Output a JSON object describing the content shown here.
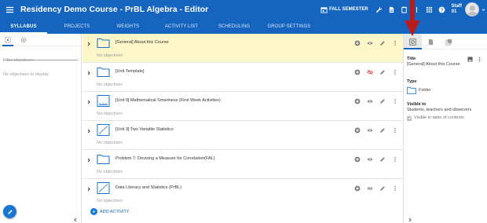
{
  "app": {
    "title": "Residency Demo Course - PrBL Algebra - Editor",
    "semester": "FALL SEMESTER",
    "user_line1": "Staff",
    "user_line2": "01"
  },
  "nav": {
    "tabs": [
      {
        "label": "SYLLABUS",
        "active": true
      },
      {
        "label": "PROJECTS",
        "active": false
      },
      {
        "label": "WEIGHTS",
        "active": false
      },
      {
        "label": "ACTIVITY LIST",
        "active": false
      },
      {
        "label": "SCHEDULING",
        "active": false
      },
      {
        "label": "GROUP SETTINGS",
        "active": false
      }
    ]
  },
  "left": {
    "filter_placeholder": "Filter objectives",
    "empty_text": "No objectives to display"
  },
  "activities": [
    {
      "title": "[General] About this Course",
      "subtitle": "No objectives",
      "icon": "folder-icon",
      "selected": true,
      "hidden": false
    },
    {
      "title": "[Unit Template]",
      "subtitle": "No objectives",
      "icon": "folder-icon",
      "selected": false,
      "hidden": true
    },
    {
      "title": "[Unit 0] Mathematical Smartness (First Week Activities)",
      "subtitle": "No objectives",
      "icon": "chart-icon",
      "selected": false,
      "hidden": false
    },
    {
      "title": "[Unit 3] Two Variable Statistics",
      "subtitle": "No objectives",
      "icon": "line-chart-icon",
      "selected": false,
      "hidden": false
    },
    {
      "title": "Problem 7: Devising a Measure for Correlation(FAL)",
      "subtitle": "No objectives",
      "icon": "folder-icon",
      "selected": false,
      "hidden": false
    },
    {
      "title": "Data Literacy and Statistics (PrBL)",
      "subtitle": "No objectives",
      "icon": "line-chart-icon",
      "selected": false,
      "hidden": false
    }
  ],
  "add_activity_label": "ADD ACTIVITY",
  "properties": {
    "title_label": "Title",
    "title_value": "[General] About this Course",
    "type_label": "Type",
    "type_value": "Folder",
    "visible_label": "Visible to",
    "visible_value": "Students, teachers and observers",
    "visible_toc_label": "Visible in table of contents"
  },
  "colors": {
    "primary": "#1565c0",
    "selected_row": "#fdf6c9",
    "annotation_arrow": "#b71c1c"
  }
}
